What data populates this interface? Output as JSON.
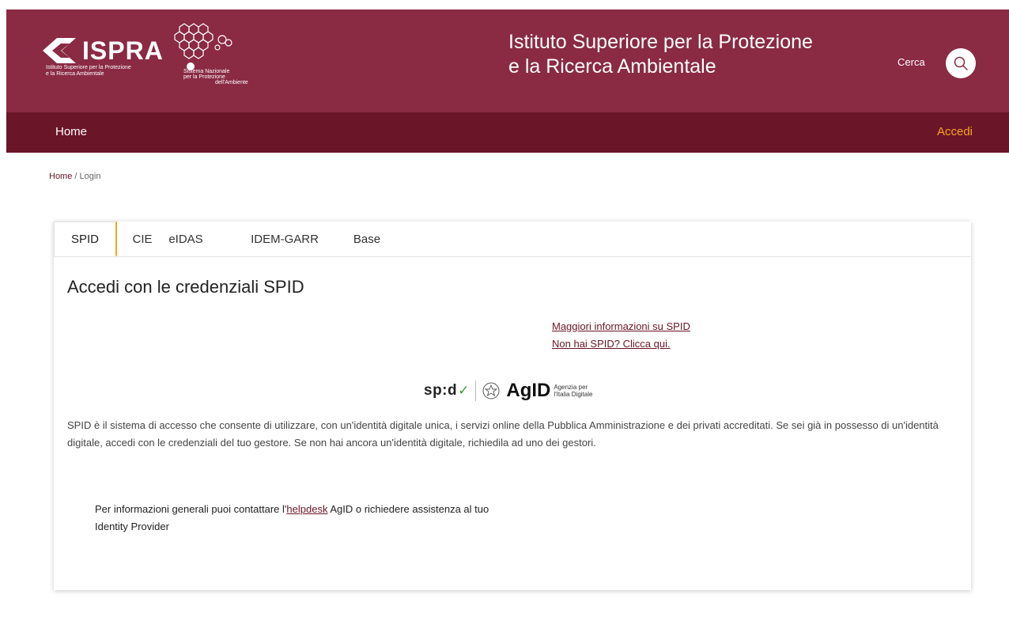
{
  "header": {
    "logo_text": "ISPRA",
    "logo_subtitle_1": "Istituto Superiore per la Protezione",
    "logo_subtitle_2": "e la Ricerca Ambientale",
    "snpa_line_1": "Sistema Nazionale",
    "snpa_line_2": "per la Protezione",
    "snpa_line_3": "dell'Ambiente",
    "title_line_1": "Istituto Superiore per la Protezione",
    "title_line_2": "e la Ricerca Ambientale",
    "search_label": "Cerca",
    "search_icon": "search-icon"
  },
  "nav": {
    "home": "Home",
    "login": "Accedi"
  },
  "breadcrumb": {
    "home": "Home",
    "separator": " / ",
    "current": "Login"
  },
  "tabs": [
    {
      "label": "SPID",
      "active": true
    },
    {
      "label": "CIE",
      "active": false
    },
    {
      "label": "eIDAS",
      "active": false
    },
    {
      "label": "IDEM-GARR",
      "active": false
    },
    {
      "label": "Base",
      "active": false
    }
  ],
  "content": {
    "title": "Accedi con le credenziali SPID",
    "link_more_info": "Maggiori informazioni su SPID",
    "link_no_spid": "Non hai SPID? Clicca qui.",
    "spid_logo_text": "sp:d",
    "agid_logo_text": "AgID",
    "agid_sub_1": "Agenzia per",
    "agid_sub_2": "l'Italia Digitale",
    "description": "SPID è il sistema di accesso che consente di utilizzare, con un'identità digitale unica, i servizi online della Pubblica Amministrazione e dei privati accreditati. Se sei già in possesso di un'identità digitale, accedi con le credenziali del tuo gestore. Se non hai ancora un'identità digitale, richiedila ad uno dei gestori.",
    "help_before": "Per informazioni generali puoi contattare l'",
    "help_link": "helpdesk",
    "help_after": " AgID o richiedere assistenza al tuo Identity Provider"
  },
  "colors": {
    "header_bg": "#8a2a43",
    "nav_bg": "#6b1528",
    "accent": "#f5a623",
    "link": "#6b1528"
  }
}
